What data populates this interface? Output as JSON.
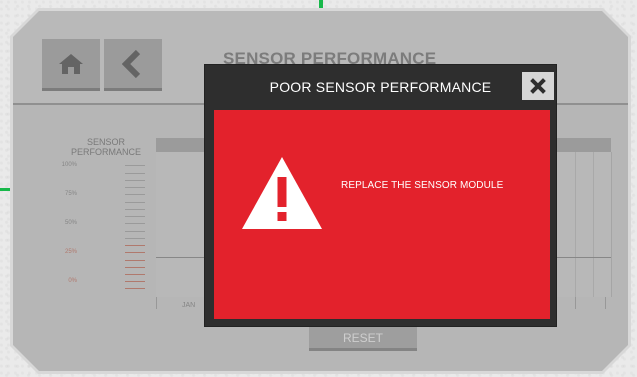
{
  "app": {
    "screen_title": "SENSOR PERFORMANCE",
    "home_icon": "home-icon",
    "back_icon": "chevron-left-icon"
  },
  "chart": {
    "axis_label_line1": "SENSOR",
    "axis_label_line2": "PERFORMANCE",
    "ticks": [
      "100%",
      "75%",
      "50%",
      "25%",
      "0%"
    ],
    "first_month": "JAN"
  },
  "reset_label": "RESET",
  "modal": {
    "title": "POOR SENSOR PERFORMANCE",
    "close_icon": "close-icon",
    "warning_icon": "warning-triangle-icon",
    "message": "REPLACE THE SENSOR MODULE"
  },
  "colors": {
    "modal_body": "#e3222c",
    "modal_frame": "#2e2e2e",
    "accent": "#18b84a"
  }
}
